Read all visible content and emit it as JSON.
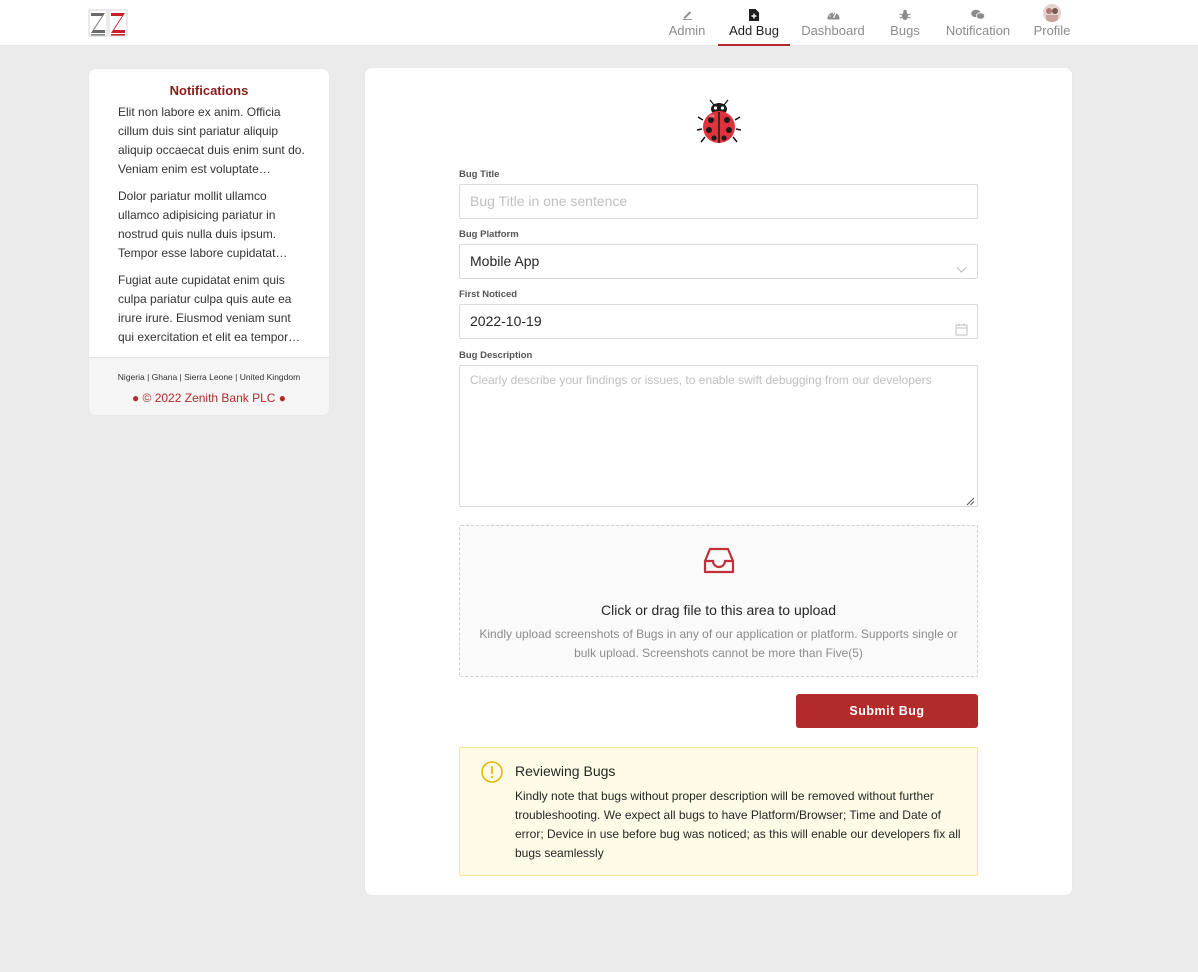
{
  "header": {
    "nav": [
      {
        "label": "Admin",
        "icon": "edit-icon"
      },
      {
        "label": "Add Bug",
        "icon": "file-add-icon",
        "active": true
      },
      {
        "label": "Dashboard",
        "icon": "dashboard-icon"
      },
      {
        "label": "Bugs",
        "icon": "bug-icon"
      },
      {
        "label": "Notification",
        "icon": "wechat-icon"
      },
      {
        "label": "Profile",
        "icon": "avatar"
      }
    ]
  },
  "sidebar": {
    "title": "Notifications",
    "items": [
      "Elit non labore ex anim. Officia cillum duis sint pariatur aliquip aliquip occaecat duis enim sunt do. Veniam enim est voluptate…",
      "Dolor pariatur mollit ullamco ullamco adipisicing pariatur in nostrud quis nulla duis ipsum. Tempor esse labore cupidatat…",
      "Fugiat aute cupidatat enim quis culpa pariatur culpa quis aute ea irure irure. Eiusmod veniam sunt qui exercitation et elit ea tempor…"
    ],
    "countries": "Nigeria | Ghana | Sierra Leone | United Kingdom",
    "copyright": "● © 2022 Zenith Bank PLC ●"
  },
  "form": {
    "bug_title_label": "Bug Title",
    "bug_title_placeholder": "Bug Title in one sentence",
    "platform_label": "Bug Platform",
    "platform_value": "Mobile App",
    "first_noticed_label": "First Noticed",
    "first_noticed_value": "2022-10-19",
    "description_label": "Bug Description",
    "description_placeholder": "Clearly describe your findings or issues, to enable swift debugging from our developers",
    "upload_title": "Click or drag file to this area to upload",
    "upload_hint": "Kindly upload screenshots of Bugs in any of our application or platform. Supports single or bulk upload. Screenshots cannot be more than Five(5)",
    "submit_label": "Submit Bug"
  },
  "alert": {
    "title": "Reviewing Bugs",
    "text": "Kindly note that bugs without proper description will be removed without further troubleshooting. We expect all bugs to have Platform/Browser; Time and Date of error; Device in use before bug was noticed; as this will enable our developers fix all bugs seamlessly"
  },
  "colors": {
    "brand": "#b22a2a",
    "alert_bg": "#fffbe6",
    "alert_border": "#ffe58f"
  }
}
